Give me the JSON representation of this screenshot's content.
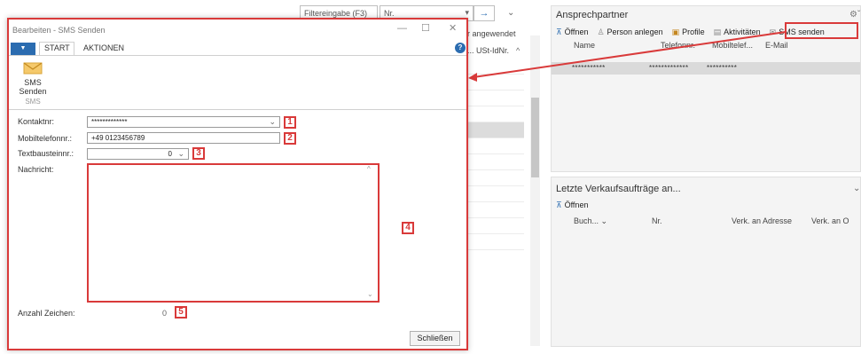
{
  "background": {
    "filter_placeholder": "Filtereingabe (F3)",
    "filter_field": "Nr.",
    "filter_go": "→",
    "applied_text": "r angewendet",
    "column_ust": "... USt-IdNr."
  },
  "contacts_panel": {
    "title": "Ansprechpartner",
    "toolbar": [
      {
        "label": "Öffnen",
        "icon": "pin-icon"
      },
      {
        "label": "Person anlegen",
        "icon": "person-icon"
      },
      {
        "label": "Profile",
        "icon": "profile-icon"
      },
      {
        "label": "Aktivitäten",
        "icon": "activity-icon"
      },
      {
        "label": "SMS senden",
        "icon": "sms-icon"
      }
    ],
    "columns": [
      "Name",
      "Telefonnr.",
      "Mobiltelef...",
      "E-Mail"
    ],
    "row": {
      "name": "***********",
      "phone": "*************",
      "mobile": "**********"
    }
  },
  "orders_panel": {
    "title": "Letzte Verkaufsaufträge an...",
    "open_label": "Öffnen",
    "columns": [
      "Buch...",
      "Nr.",
      "Verk. an Adresse",
      "Verk. an O"
    ]
  },
  "dialog": {
    "title": "Bearbeiten - SMS Senden",
    "tabs": {
      "start": "START",
      "actions": "AKTIONEN"
    },
    "sms_button": {
      "line1": "SMS",
      "line2": "Senden",
      "group": "SMS"
    },
    "fields": {
      "kontaktnr_label": "Kontaktnr:",
      "kontaktnr_value": "*************",
      "mobil_label": "Mobiltelefonnr.:",
      "mobil_value": "+49 0123456789",
      "textbaustein_label": "Textbausteinnr.:",
      "textbaustein_value": "0",
      "nachricht_label": "Nachricht:",
      "anzahl_label": "Anzahl Zeichen:",
      "anzahl_value": "0"
    },
    "close_label": "Schließen"
  },
  "markers": [
    "1",
    "2",
    "3",
    "4",
    "5"
  ],
  "colors": {
    "accent": "#2b6cb0",
    "highlight_red": "#d93a3a"
  }
}
